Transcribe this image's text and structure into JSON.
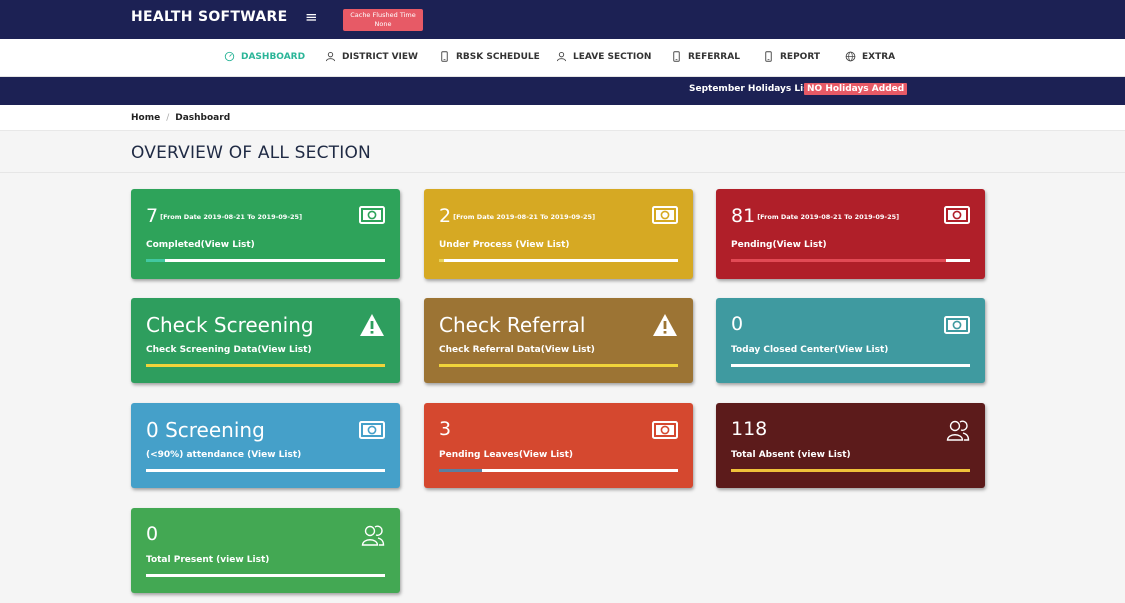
{
  "header": {
    "brand": "HEALTH SOFTWARE",
    "menu_glyph": "≡",
    "cache_line1": "Cache Flushed Time",
    "cache_line2": "None"
  },
  "nav": {
    "items": [
      {
        "label": "DASHBOARD",
        "icon": "dashboard-icon"
      },
      {
        "label": "DISTRICT VIEW",
        "icon": "user-icon"
      },
      {
        "label": "RBSK SCHEDULE",
        "icon": "mobile-icon"
      },
      {
        "label": "LEAVE SECTION",
        "icon": "user-icon"
      },
      {
        "label": "REFERRAL",
        "icon": "mobile-icon"
      },
      {
        "label": "REPORT",
        "icon": "mobile-icon"
      },
      {
        "label": "EXTRA",
        "icon": "globe-icon"
      }
    ]
  },
  "announcement": {
    "text": "September Holidays List",
    "badge": "NO Holidays Added"
  },
  "breadcrumb": {
    "home": "Home",
    "sep": "/",
    "current": "Dashboard"
  },
  "page_title": "OVERVIEW OF ALL SECTION",
  "cards": [
    {
      "value": "7",
      "date": "[From Date 2019-08-21 To 2019-09-25]",
      "label": "Completed(View List)",
      "icon": "money-icon",
      "color": "#2ea35a",
      "progress": 0.08,
      "progress_color": "#42c8a0"
    },
    {
      "value": "2",
      "date": "[From Date 2019-08-21 To 2019-09-25]",
      "label": "Under Process (View List)",
      "icon": "money-icon",
      "color": "#d6a923",
      "progress": 0.02,
      "progress_color": "#e8d35a"
    },
    {
      "value": "81",
      "date": "[From Date 2019-08-21 To 2019-09-25]",
      "label": "Pending(View List)",
      "icon": "money-icon",
      "color": "#b01f29",
      "progress": 0.9,
      "progress_color": "#e24a55"
    },
    {
      "title": "Check Screening",
      "label": "Check Screening Data(View List)",
      "icon": "warning-icon",
      "color": "#2e9e5e",
      "progress": 1.0,
      "progress_color": "#f0d43a"
    },
    {
      "title": "Check Referral",
      "label": "Check Referral Data(View List)",
      "icon": "warning-icon",
      "color": "#9c7434",
      "progress": 1.0,
      "progress_color": "#f0d43a"
    },
    {
      "value": "0",
      "label": "Today Closed Center(View List)",
      "icon": "money-icon",
      "color": "#3f9aa0",
      "progress": 0.0,
      "progress_color": "#ffffff"
    },
    {
      "title": "0 Screening",
      "label": "(<90%) attendance (View List)",
      "icon": "money-icon",
      "color": "#45a0c9",
      "progress": 0.0,
      "progress_color": "#ffffff"
    },
    {
      "value": "3",
      "label": "Pending Leaves(View List)",
      "icon": "money-icon",
      "color": "#d5482f",
      "progress": 0.18,
      "progress_color": "#5a7fa0"
    },
    {
      "value": "118",
      "label": "Total Absent (view List)",
      "icon": "users-icon",
      "color": "#5c1b1b",
      "progress": 1.0,
      "progress_color": "#f0c23a"
    },
    {
      "value": "0",
      "label": "Total Present (view List)",
      "icon": "users-icon",
      "color": "#43a853",
      "progress": 0.0,
      "progress_color": "#ffffff"
    }
  ]
}
